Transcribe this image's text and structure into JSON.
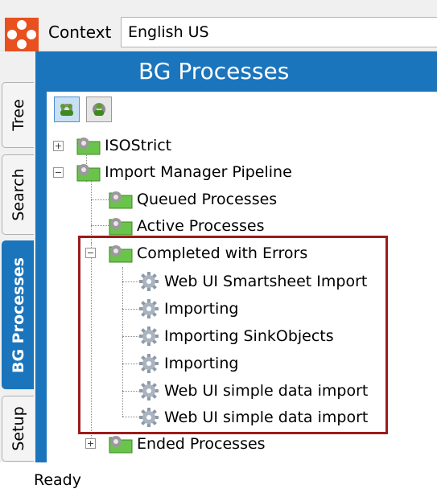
{
  "context": {
    "label": "Context",
    "value": "English US"
  },
  "tabs": [
    {
      "label": "Tree",
      "active": false
    },
    {
      "label": "Search",
      "active": false
    },
    {
      "label": "BG Processes",
      "active": true
    },
    {
      "label": "Setup",
      "active": false
    }
  ],
  "panel": {
    "title": "BG Processes"
  },
  "tree": {
    "nodes": [
      {
        "label": "ISOStrict",
        "icon": "folder-gear-icon",
        "expander": "+"
      },
      {
        "label": "Import Manager Pipeline",
        "icon": "folder-gear-icon",
        "expander": "−"
      },
      {
        "label": "Queued Processes",
        "icon": "folder-gear-icon"
      },
      {
        "label": "Active Processes",
        "icon": "folder-gear-icon"
      },
      {
        "label": "Completed with Errors",
        "icon": "folder-gear-icon",
        "expander": "−"
      },
      {
        "label": "Web UI Smartsheet Import",
        "icon": "gear-icon"
      },
      {
        "label": "Importing",
        "icon": "gear-icon"
      },
      {
        "label": "Importing SinkObjects",
        "icon": "gear-icon"
      },
      {
        "label": "Importing",
        "icon": "gear-icon"
      },
      {
        "label": "Web UI simple data import",
        "icon": "gear-icon"
      },
      {
        "label": "Web UI simple data import",
        "icon": "gear-icon"
      },
      {
        "label": "Ended Processes",
        "icon": "folder-gear-icon",
        "expander": "+"
      }
    ]
  },
  "status": {
    "text": "Ready"
  },
  "colors": {
    "accent": "#1b75bc",
    "logo": "#e8501f",
    "highlight": "#9b1b1b"
  }
}
